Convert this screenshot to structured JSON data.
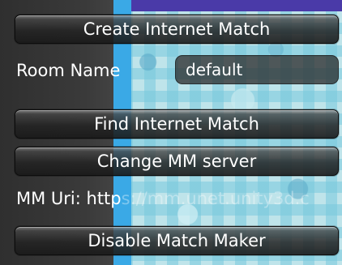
{
  "menu": {
    "create_button": "Create Internet Match",
    "room_name_label": "Room Name",
    "room_name_value": "default",
    "find_button": "Find Internet Match",
    "change_server_button": "Change MM server",
    "mm_uri_label": "MM Uri:",
    "mm_uri_value_visible": "http",
    "mm_uri_value_faded": "s://mm.unet.unity3d.c",
    "disable_button": "Disable Match Maker"
  },
  "colors": {
    "text": "#ffffff",
    "button_dark": "#1e1e1e",
    "scene_blue": "#3aa9e6",
    "scene_purple": "#4a3aa8",
    "scene_light": "#bfe4ea"
  }
}
